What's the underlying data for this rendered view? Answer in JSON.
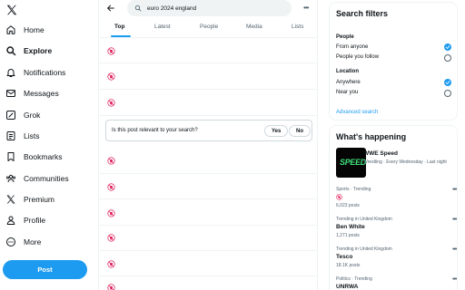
{
  "nav": {
    "logo_icon": "x-logo-icon",
    "items": [
      {
        "label": "Home",
        "icon": "home-icon"
      },
      {
        "label": "Explore",
        "icon": "search-icon",
        "active": true
      },
      {
        "label": "Notifications",
        "icon": "bell-icon"
      },
      {
        "label": "Messages",
        "icon": "envelope-icon"
      },
      {
        "label": "Grok",
        "icon": "grok-icon"
      },
      {
        "label": "Lists",
        "icon": "list-icon"
      },
      {
        "label": "Bookmarks",
        "icon": "bookmark-icon"
      },
      {
        "label": "Communities",
        "icon": "communities-icon"
      },
      {
        "label": "Premium",
        "icon": "x-logo-icon"
      },
      {
        "label": "Profile",
        "icon": "person-icon"
      },
      {
        "label": "More",
        "icon": "more-circle-icon"
      }
    ],
    "post_label": "Post"
  },
  "main": {
    "search_value": "euro 2024 england",
    "tabs": [
      {
        "label": "Top",
        "active": true
      },
      {
        "label": "Latest"
      },
      {
        "label": "People"
      },
      {
        "label": "Media"
      },
      {
        "label": "Lists"
      }
    ],
    "relevance": {
      "question": "Is this post relevant to your search?",
      "yes": "Yes",
      "no": "No"
    }
  },
  "filters": {
    "title": "Search filters",
    "people_heading": "People",
    "people_options": [
      "From anyone",
      "People you follow"
    ],
    "people_selected": 0,
    "location_heading": "Location",
    "location_options": [
      "Anywhere",
      "Near you"
    ],
    "location_selected": 0,
    "advanced": "Advanced search"
  },
  "happening": {
    "title": "What's happening",
    "featured": {
      "thumb_text": "SPEED",
      "title": "WWE Speed",
      "subtitle": "Wrestling · Every Wednesday · Last night"
    },
    "trends": [
      {
        "meta": "Sports · Trending",
        "name": "",
        "count": "6,023 posts"
      },
      {
        "meta": "Trending in United Kingdom",
        "name": "Ben White",
        "count": "1,271 posts"
      },
      {
        "meta": "Trending in United Kingdom",
        "name": "Tesco",
        "count": "18.1K posts"
      },
      {
        "meta": "Politics · Trending",
        "name": "UNRWA",
        "count": ""
      }
    ]
  },
  "colors": {
    "accent": "#1d9bf0",
    "text": "#0f1419",
    "muted": "#536471",
    "border": "#eff3f4"
  }
}
